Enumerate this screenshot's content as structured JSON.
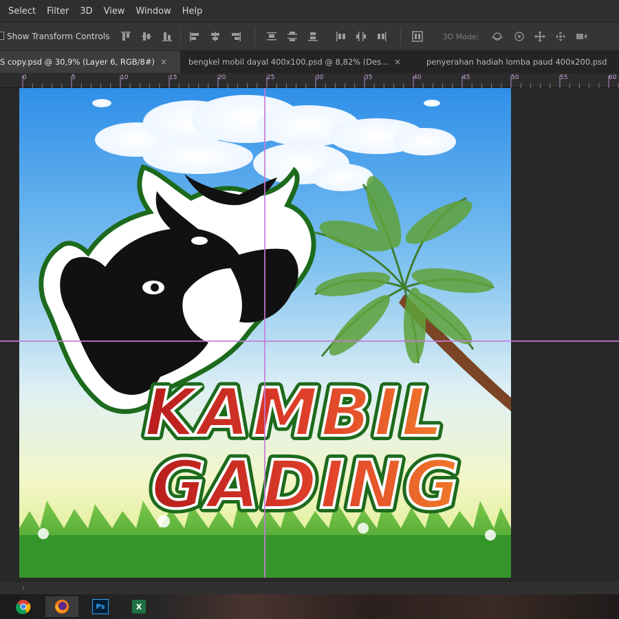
{
  "menu": [
    "Select",
    "Filter",
    "3D",
    "View",
    "Window",
    "Help"
  ],
  "options": {
    "show_transform_label": "Show Transform Controls",
    "mode3d_label": "3D Mode:"
  },
  "tabs": [
    {
      "label": "S copy.psd @ 30,9% (Layer 6, RGB/8#)",
      "active": true
    },
    {
      "label": "bengkel mobil dayal 400x100.psd @ 8,82% (Des...",
      "active": false
    },
    {
      "label": "penyerahan hadiah lomba paud 400x200.psd",
      "active": false
    }
  ],
  "tab_close_glyph": "×",
  "ruler_labels": [
    "0",
    "5",
    "10",
    "15",
    "20",
    "25",
    "30",
    "35",
    "40",
    "45",
    "50",
    "55",
    "60"
  ],
  "artwork": {
    "line1": "KAMBIL",
    "line2": "GADING"
  },
  "scroll_arrow": "›",
  "taskbar": {
    "photoshop_label": "Ps",
    "excel_label": "X"
  },
  "colors": {
    "guide": "#c67ad8",
    "ruler_text": "#c6a7d8",
    "sky_top": "#2f8fe8",
    "grass": "#3aa02c",
    "text_red": "#b81d1d"
  }
}
